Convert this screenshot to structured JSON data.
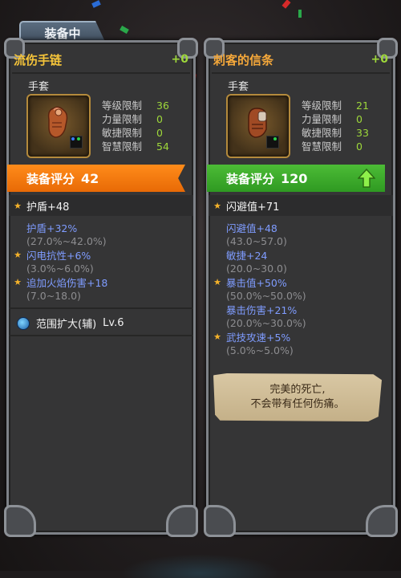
{
  "equipped_tab": "装备中",
  "left": {
    "item_name": "流伤手链",
    "plus": "+0",
    "type_label": "手套",
    "requirements": [
      {
        "name": "等级限制",
        "value": "36"
      },
      {
        "name": "力量限制",
        "value": "0"
      },
      {
        "name": "敏捷限制",
        "value": "0"
      },
      {
        "name": "智慧限制",
        "value": "54"
      }
    ],
    "score_label": "装备评分",
    "score_value": "42",
    "main_stat": "护盾+48",
    "attributes": [
      {
        "name": "护盾+32%",
        "range": "(27.0%~42.0%)",
        "star": false
      },
      {
        "name": "闪电抗性+6%",
        "range": "(3.0%~6.0%)",
        "star": true
      },
      {
        "name": "追加火焰伤害+18",
        "range": "(7.0~18.0)",
        "star": true
      }
    ],
    "skill_name": "范围扩大(辅)",
    "skill_level": "Lv.6"
  },
  "right": {
    "item_name": "刺客的信条",
    "plus": "+0",
    "type_label": "手套",
    "requirements": [
      {
        "name": "等级限制",
        "value": "21"
      },
      {
        "name": "力量限制",
        "value": "0"
      },
      {
        "name": "敏捷限制",
        "value": "33"
      },
      {
        "name": "智慧限制",
        "value": "0"
      }
    ],
    "score_label": "装备评分",
    "score_value": "120",
    "main_stat": "闪避值+71",
    "attributes": [
      {
        "name": "闪避值+48",
        "range": "(43.0~57.0)",
        "star": false
      },
      {
        "name": "敏捷+24",
        "range": "(20.0~30.0)",
        "star": false
      },
      {
        "name": "暴击值+50%",
        "range": "(50.0%~50.0%)",
        "star": true
      },
      {
        "name": "暴击伤害+21%",
        "range": "(20.0%~30.0%)",
        "star": false
      },
      {
        "name": "武技攻速+5%",
        "range": "(5.0%~5.0%)",
        "star": true
      }
    ],
    "quote_line1": "完美的死亡,",
    "quote_line2": "不会带有任何伤痛。"
  },
  "colors": {
    "item_name": "#f5c43a",
    "plus": "#9ed83a",
    "attribute": "#7f9cff",
    "range": "#8d8d90",
    "score_left": "#ff8c1a",
    "score_right": "#4cbc36"
  }
}
